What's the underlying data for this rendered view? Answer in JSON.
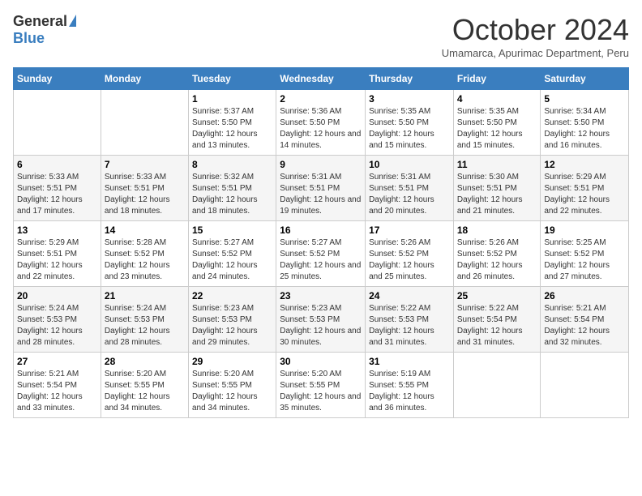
{
  "logo": {
    "general": "General",
    "blue": "Blue"
  },
  "header": {
    "month": "October 2024",
    "location": "Umamarca, Apurimac Department, Peru"
  },
  "days_of_week": [
    "Sunday",
    "Monday",
    "Tuesday",
    "Wednesday",
    "Thursday",
    "Friday",
    "Saturday"
  ],
  "weeks": [
    [
      {
        "day": "",
        "sunrise": "",
        "sunset": "",
        "daylight": ""
      },
      {
        "day": "",
        "sunrise": "",
        "sunset": "",
        "daylight": ""
      },
      {
        "day": "1",
        "sunrise": "Sunrise: 5:37 AM",
        "sunset": "Sunset: 5:50 PM",
        "daylight": "Daylight: 12 hours and 13 minutes."
      },
      {
        "day": "2",
        "sunrise": "Sunrise: 5:36 AM",
        "sunset": "Sunset: 5:50 PM",
        "daylight": "Daylight: 12 hours and 14 minutes."
      },
      {
        "day": "3",
        "sunrise": "Sunrise: 5:35 AM",
        "sunset": "Sunset: 5:50 PM",
        "daylight": "Daylight: 12 hours and 15 minutes."
      },
      {
        "day": "4",
        "sunrise": "Sunrise: 5:35 AM",
        "sunset": "Sunset: 5:50 PM",
        "daylight": "Daylight: 12 hours and 15 minutes."
      },
      {
        "day": "5",
        "sunrise": "Sunrise: 5:34 AM",
        "sunset": "Sunset: 5:50 PM",
        "daylight": "Daylight: 12 hours and 16 minutes."
      }
    ],
    [
      {
        "day": "6",
        "sunrise": "Sunrise: 5:33 AM",
        "sunset": "Sunset: 5:51 PM",
        "daylight": "Daylight: 12 hours and 17 minutes."
      },
      {
        "day": "7",
        "sunrise": "Sunrise: 5:33 AM",
        "sunset": "Sunset: 5:51 PM",
        "daylight": "Daylight: 12 hours and 18 minutes."
      },
      {
        "day": "8",
        "sunrise": "Sunrise: 5:32 AM",
        "sunset": "Sunset: 5:51 PM",
        "daylight": "Daylight: 12 hours and 18 minutes."
      },
      {
        "day": "9",
        "sunrise": "Sunrise: 5:31 AM",
        "sunset": "Sunset: 5:51 PM",
        "daylight": "Daylight: 12 hours and 19 minutes."
      },
      {
        "day": "10",
        "sunrise": "Sunrise: 5:31 AM",
        "sunset": "Sunset: 5:51 PM",
        "daylight": "Daylight: 12 hours and 20 minutes."
      },
      {
        "day": "11",
        "sunrise": "Sunrise: 5:30 AM",
        "sunset": "Sunset: 5:51 PM",
        "daylight": "Daylight: 12 hours and 21 minutes."
      },
      {
        "day": "12",
        "sunrise": "Sunrise: 5:29 AM",
        "sunset": "Sunset: 5:51 PM",
        "daylight": "Daylight: 12 hours and 22 minutes."
      }
    ],
    [
      {
        "day": "13",
        "sunrise": "Sunrise: 5:29 AM",
        "sunset": "Sunset: 5:51 PM",
        "daylight": "Daylight: 12 hours and 22 minutes."
      },
      {
        "day": "14",
        "sunrise": "Sunrise: 5:28 AM",
        "sunset": "Sunset: 5:52 PM",
        "daylight": "Daylight: 12 hours and 23 minutes."
      },
      {
        "day": "15",
        "sunrise": "Sunrise: 5:27 AM",
        "sunset": "Sunset: 5:52 PM",
        "daylight": "Daylight: 12 hours and 24 minutes."
      },
      {
        "day": "16",
        "sunrise": "Sunrise: 5:27 AM",
        "sunset": "Sunset: 5:52 PM",
        "daylight": "Daylight: 12 hours and 25 minutes."
      },
      {
        "day": "17",
        "sunrise": "Sunrise: 5:26 AM",
        "sunset": "Sunset: 5:52 PM",
        "daylight": "Daylight: 12 hours and 25 minutes."
      },
      {
        "day": "18",
        "sunrise": "Sunrise: 5:26 AM",
        "sunset": "Sunset: 5:52 PM",
        "daylight": "Daylight: 12 hours and 26 minutes."
      },
      {
        "day": "19",
        "sunrise": "Sunrise: 5:25 AM",
        "sunset": "Sunset: 5:52 PM",
        "daylight": "Daylight: 12 hours and 27 minutes."
      }
    ],
    [
      {
        "day": "20",
        "sunrise": "Sunrise: 5:24 AM",
        "sunset": "Sunset: 5:53 PM",
        "daylight": "Daylight: 12 hours and 28 minutes."
      },
      {
        "day": "21",
        "sunrise": "Sunrise: 5:24 AM",
        "sunset": "Sunset: 5:53 PM",
        "daylight": "Daylight: 12 hours and 28 minutes."
      },
      {
        "day": "22",
        "sunrise": "Sunrise: 5:23 AM",
        "sunset": "Sunset: 5:53 PM",
        "daylight": "Daylight: 12 hours and 29 minutes."
      },
      {
        "day": "23",
        "sunrise": "Sunrise: 5:23 AM",
        "sunset": "Sunset: 5:53 PM",
        "daylight": "Daylight: 12 hours and 30 minutes."
      },
      {
        "day": "24",
        "sunrise": "Sunrise: 5:22 AM",
        "sunset": "Sunset: 5:53 PM",
        "daylight": "Daylight: 12 hours and 31 minutes."
      },
      {
        "day": "25",
        "sunrise": "Sunrise: 5:22 AM",
        "sunset": "Sunset: 5:54 PM",
        "daylight": "Daylight: 12 hours and 31 minutes."
      },
      {
        "day": "26",
        "sunrise": "Sunrise: 5:21 AM",
        "sunset": "Sunset: 5:54 PM",
        "daylight": "Daylight: 12 hours and 32 minutes."
      }
    ],
    [
      {
        "day": "27",
        "sunrise": "Sunrise: 5:21 AM",
        "sunset": "Sunset: 5:54 PM",
        "daylight": "Daylight: 12 hours and 33 minutes."
      },
      {
        "day": "28",
        "sunrise": "Sunrise: 5:20 AM",
        "sunset": "Sunset: 5:55 PM",
        "daylight": "Daylight: 12 hours and 34 minutes."
      },
      {
        "day": "29",
        "sunrise": "Sunrise: 5:20 AM",
        "sunset": "Sunset: 5:55 PM",
        "daylight": "Daylight: 12 hours and 34 minutes."
      },
      {
        "day": "30",
        "sunrise": "Sunrise: 5:20 AM",
        "sunset": "Sunset: 5:55 PM",
        "daylight": "Daylight: 12 hours and 35 minutes."
      },
      {
        "day": "31",
        "sunrise": "Sunrise: 5:19 AM",
        "sunset": "Sunset: 5:55 PM",
        "daylight": "Daylight: 12 hours and 36 minutes."
      },
      {
        "day": "",
        "sunrise": "",
        "sunset": "",
        "daylight": ""
      },
      {
        "day": "",
        "sunrise": "",
        "sunset": "",
        "daylight": ""
      }
    ]
  ]
}
